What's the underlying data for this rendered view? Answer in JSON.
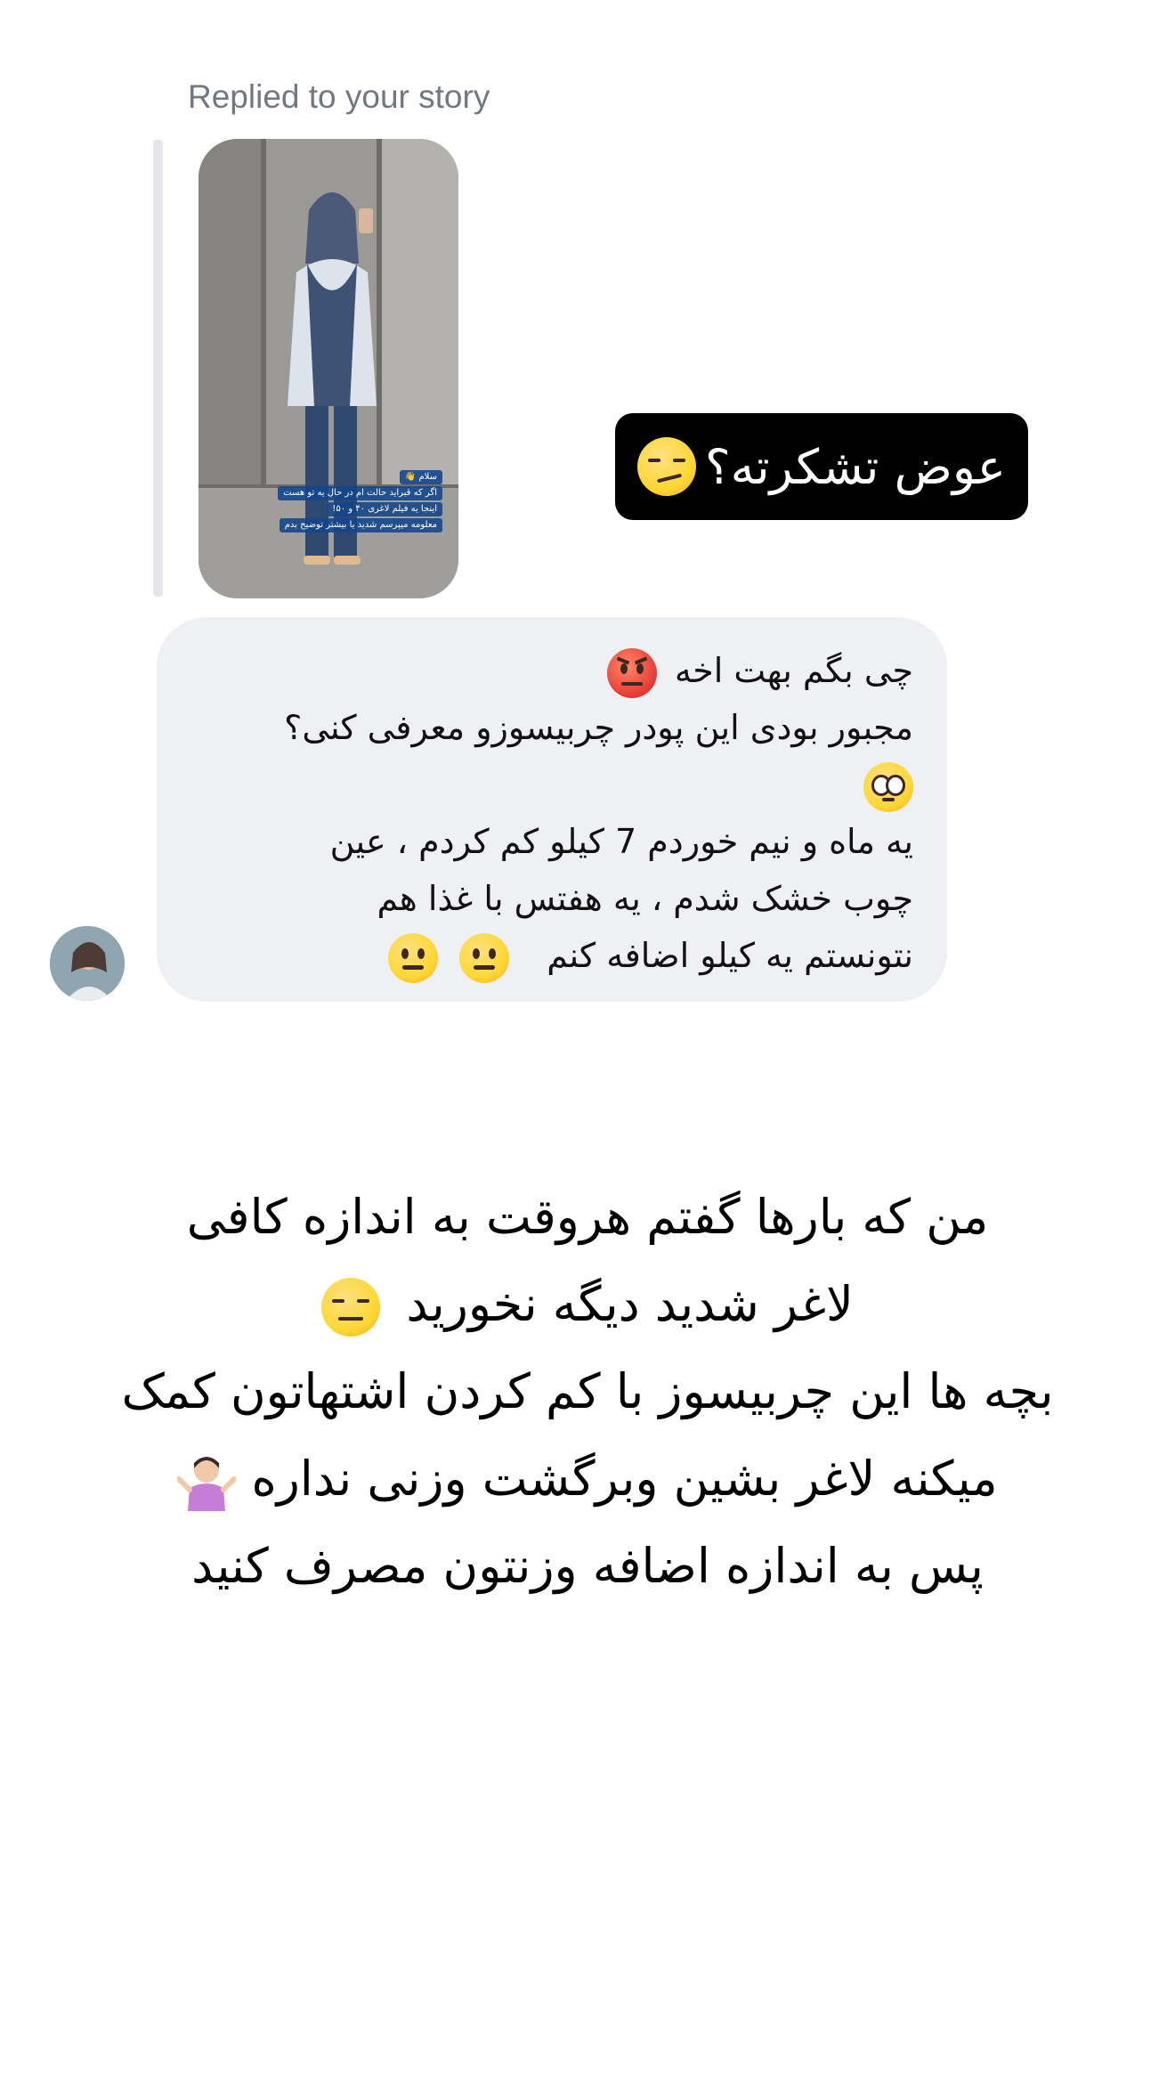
{
  "reply": {
    "label": "Replied to your story"
  },
  "story": {
    "sticker_text": "عوض تشکرته؟",
    "sticker_emoji": "smirking-face",
    "thumbnail_caption": [
      "سلام 👋",
      "اگر که قبراید حالت ام در حال یه تو هست",
      "اینجا یه فیلم لاغری ۴۰ و ۵۰!",
      "معلومه میپرسم شدید یا بیشتر توضیح بدم"
    ]
  },
  "message": {
    "lines": [
      "چی بگم بهت اخه",
      "مجبور بودی این پودر چربیسوزو معرفی کنی؟",
      "",
      "یه ماه و نیم خوردم 7 کیلو کم کردم ، عین",
      "چوب خشک شدم ، یه هفتس با غذا هم",
      "نتونستم یه کیلو اضافه کنم"
    ],
    "emojis": [
      "angry-face",
      "pleading-face",
      "neutral-face",
      "neutral-face"
    ]
  },
  "overlay_text": {
    "lines": [
      "من که بارها گفتم هروقت به اندازه کافی",
      "لاغر شدید دیگه نخورید",
      "بچه ها این چربیسوز با کم کردن اشتهاتون کمک",
      "میکنه لاغر بشین وبرگشت وزنی نداره",
      "پس به اندازه اضافه وزنتون مصرف کنید"
    ],
    "emojis": [
      "expressionless-face",
      "person-shrugging"
    ]
  }
}
